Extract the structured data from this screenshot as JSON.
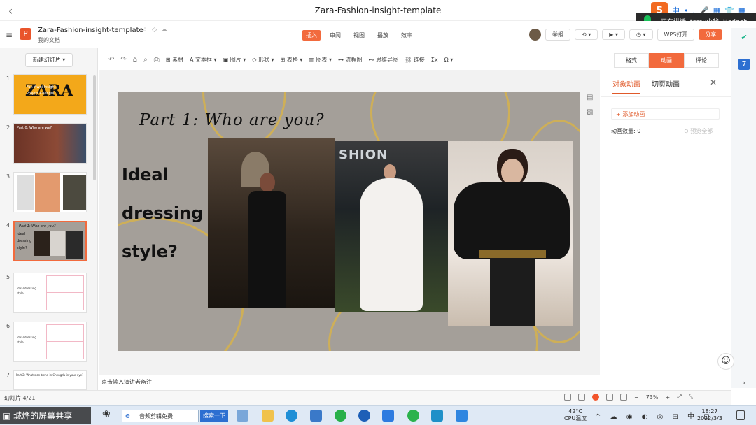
{
  "window": {
    "title": "Zara-Fashion-insight-template"
  },
  "app": {
    "doc_name": "Zara-Fashion-insight-template",
    "doc_location": "我的文档",
    "menu_tabs": [
      {
        "label": "插入",
        "active": true
      },
      {
        "label": "审阅",
        "active": false
      },
      {
        "label": "视图",
        "active": false
      },
      {
        "label": "播放",
        "active": false
      },
      {
        "label": "效率",
        "active": false
      }
    ],
    "report_label": "举报",
    "wps_open_label": "WPS打开",
    "share_label": "分享"
  },
  "meeting": {
    "speaking_text": "正在讲话: tomy少爷; Hedgeh"
  },
  "ime": {
    "mode": "中",
    "extras": [
      "•",
      ",",
      "🎤",
      "▦",
      "👕",
      "▦"
    ]
  },
  "left_panel": {
    "new_slide_label": "新建幻灯片",
    "slides": [
      {
        "num": "1",
        "title": "ZARA",
        "sub": "Fan Yiwei Insight Project Chengdu"
      },
      {
        "num": "2",
        "title": "Part 0: Who are we?"
      },
      {
        "num": "3",
        "title": ""
      },
      {
        "num": "4",
        "title": "Part 1: Who are you?",
        "selected": true
      },
      {
        "num": "5",
        "title": "Ideal dressing style"
      },
      {
        "num": "6",
        "title": "Ideal dressing style"
      },
      {
        "num": "7",
        "title": "Part 2: What's on trend in Chengdu in your eye?"
      }
    ]
  },
  "ribbon": {
    "items": [
      "素材",
      "文本框",
      "图片",
      "形状",
      "表格",
      "图表",
      "流程图",
      "思维导图",
      "链接",
      "Σx",
      "Ω"
    ]
  },
  "slide": {
    "title": "Part 1:  Who are you?",
    "left_lines": [
      "Ideal",
      "dressing",
      "style?"
    ],
    "photo_caption": "SHION"
  },
  "notes": {
    "placeholder": "点击输入演讲者备注"
  },
  "right_panel": {
    "tabs": [
      {
        "label": "格式",
        "active": false
      },
      {
        "label": "动画",
        "active": true
      },
      {
        "label": "评论",
        "active": false
      }
    ],
    "subtabs": [
      "对象动画",
      "切页动画"
    ],
    "add_animation_label": "+ 添加动画",
    "animation_count_label": "动画数量: 0",
    "preview_all_label": "预览全部"
  },
  "status": {
    "page_indicator": "幻灯片 4/21",
    "zoom": "73%"
  },
  "taskbar": {
    "watermark": "城烨的屏幕共享",
    "search_text": "音频剪辑免费",
    "search_button": "搜索一下",
    "weather_temp": "42°C",
    "weather_label": "CPU温度",
    "input_lang": "中",
    "time": "18:27",
    "date": "2022/3/3"
  },
  "colors": {
    "accent": "#f26a3d",
    "gold": "#d6b24c",
    "slide_bg": "#a49f99"
  }
}
